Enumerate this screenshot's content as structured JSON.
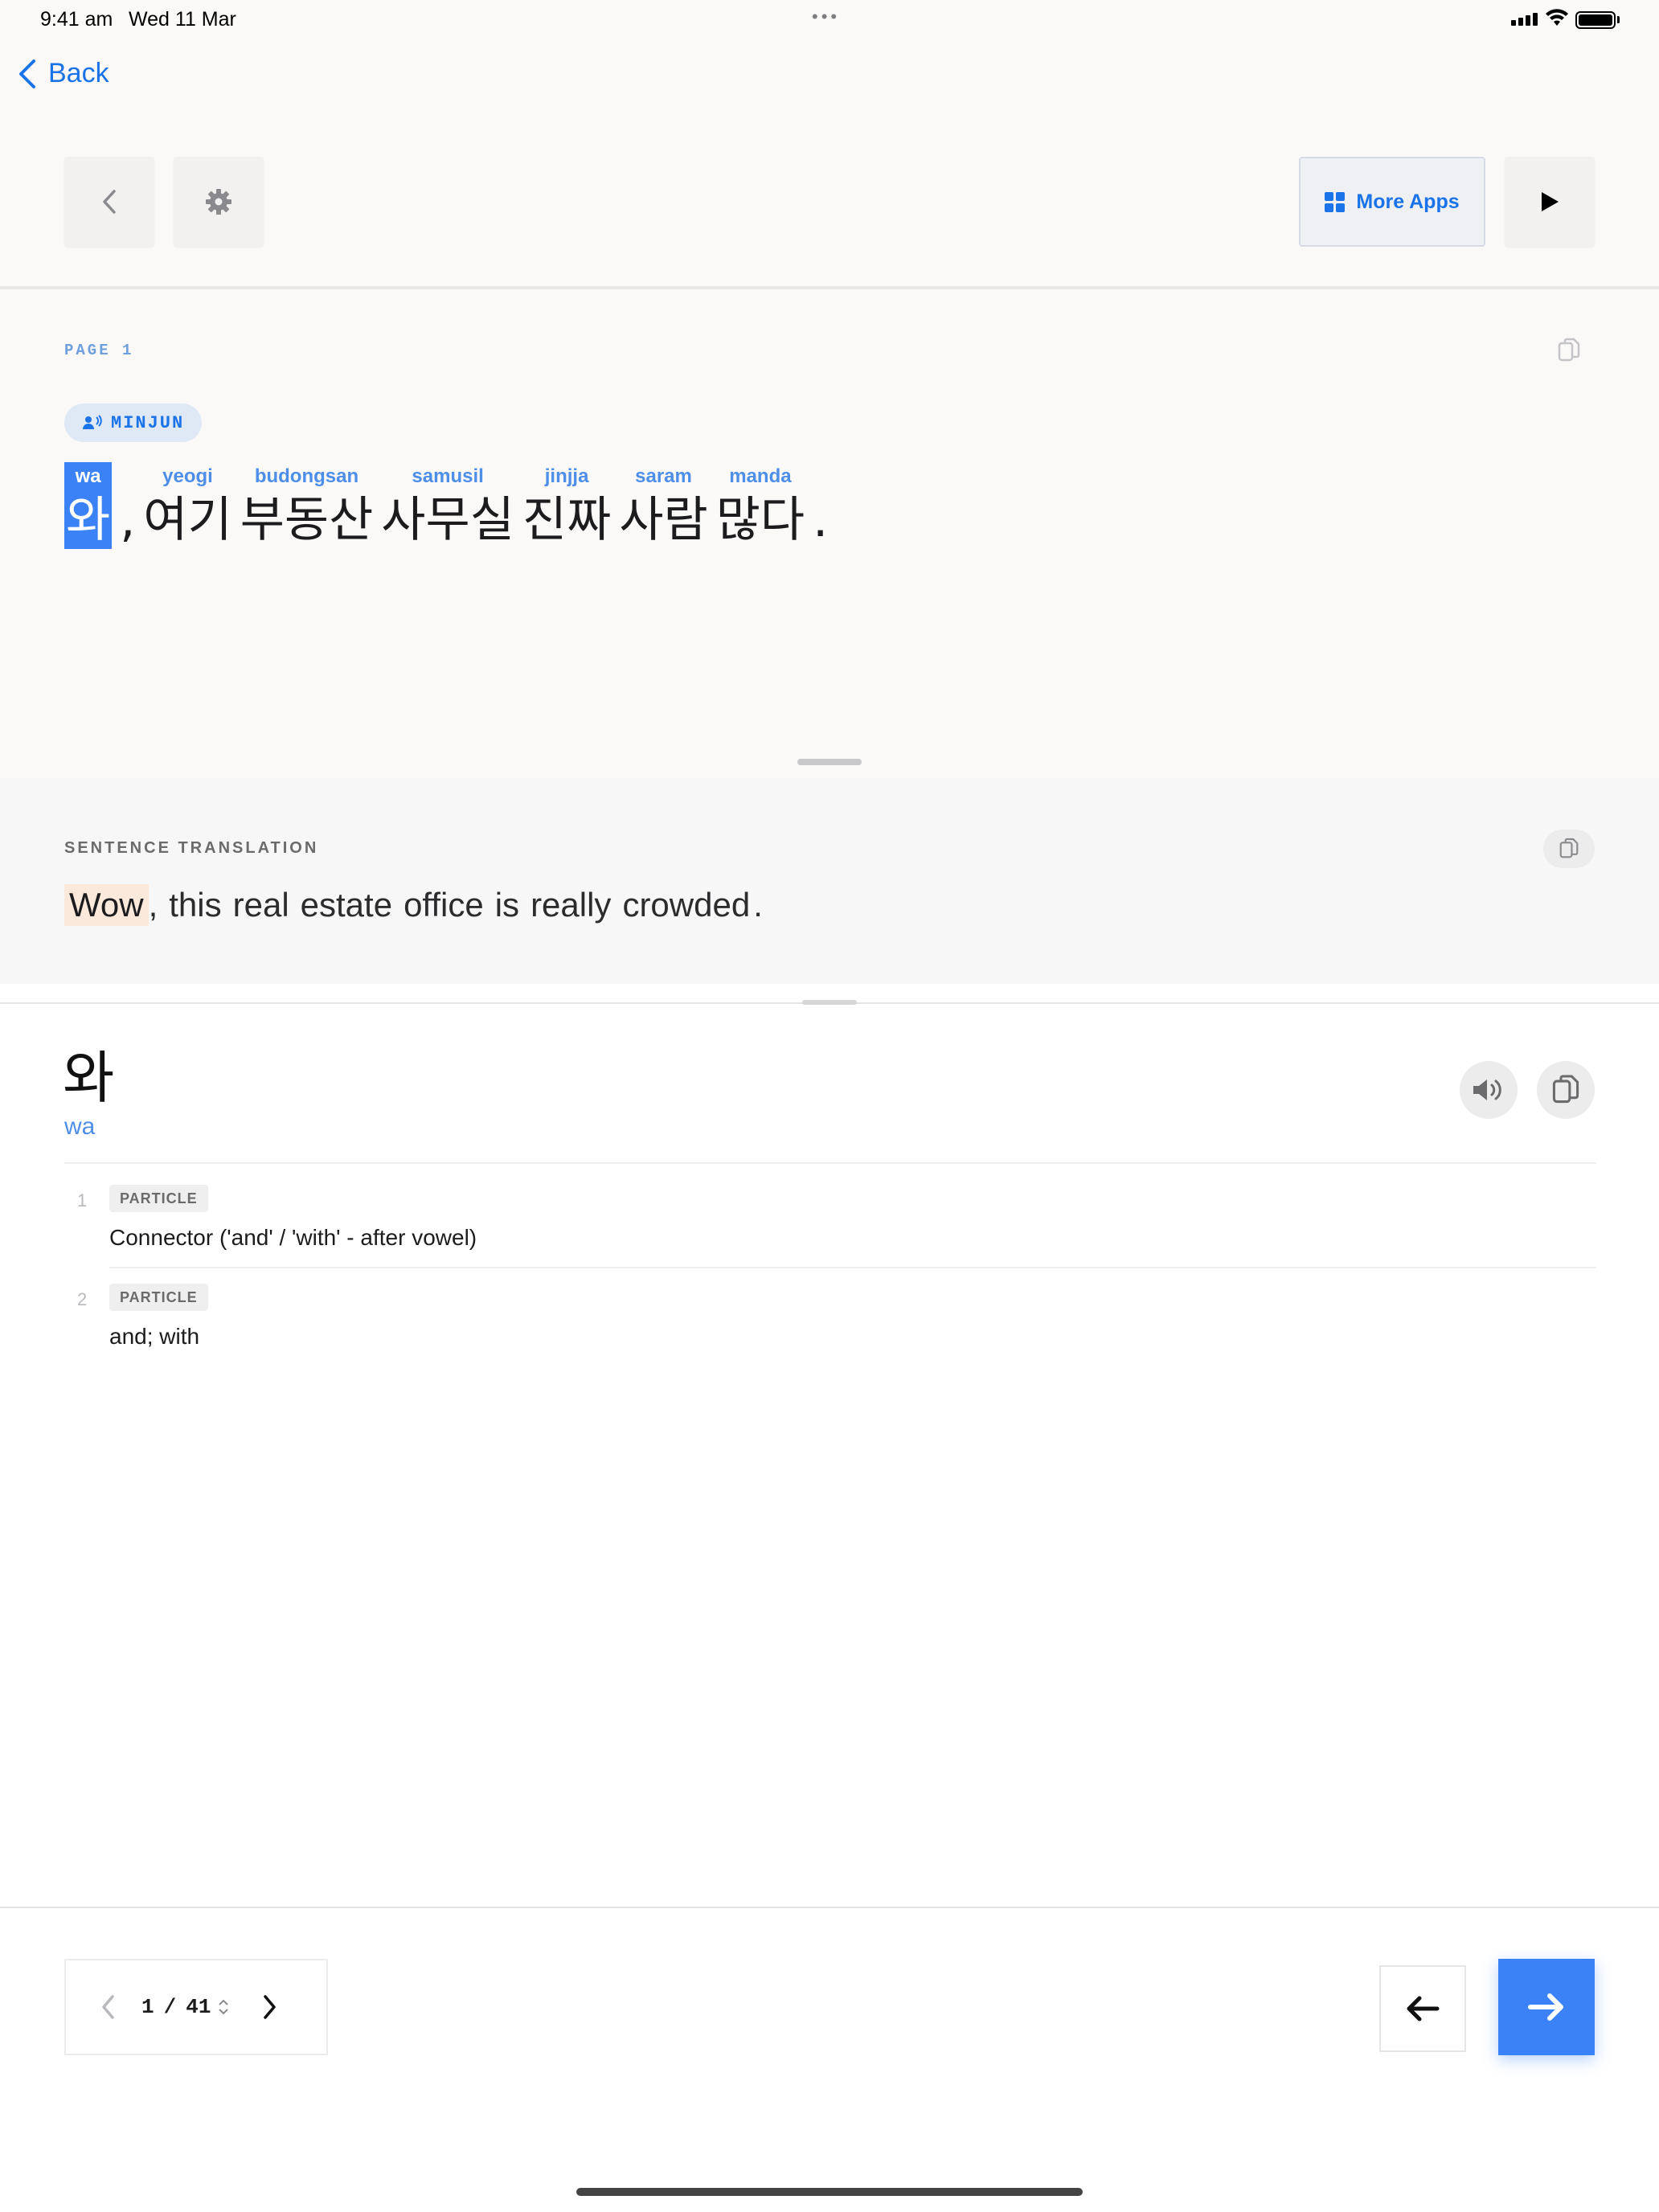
{
  "status_bar": {
    "time": "9:41 am",
    "date": "Wed 11 Mar",
    "dots": "•••"
  },
  "nav": {
    "back_label": "Back"
  },
  "toolbar": {
    "more_apps_label": "More Apps"
  },
  "page": {
    "label": "PAGE 1",
    "speaker": "MINJUN",
    "tokens": [
      {
        "rom": "wa",
        "kor": "와",
        "active": true
      },
      {
        "rom": "yeogi",
        "kor": "여기"
      },
      {
        "rom": "budongsan",
        "kor": "부동산"
      },
      {
        "rom": "samusil",
        "kor": "사무실"
      },
      {
        "rom": "jinjja",
        "kor": "진짜"
      },
      {
        "rom": "saram",
        "kor": "사람"
      },
      {
        "rom": "manda",
        "kor": "많다"
      }
    ],
    "comma": ",",
    "period": "."
  },
  "translation": {
    "label": "SENTENCE TRANSLATION",
    "highlight": "Wow",
    "rest": [
      ",",
      "this",
      "real",
      "estate",
      "office",
      "is",
      "really",
      "crowded",
      "."
    ]
  },
  "dictionary": {
    "word": "와",
    "romanization": "wa",
    "definitions": [
      {
        "num": "1",
        "pos": "PARTICLE",
        "text": "Connector ('and' / 'with' - after vowel)"
      },
      {
        "num": "2",
        "pos": "PARTICLE",
        "text": "and; with"
      }
    ]
  },
  "pager": {
    "current": "1",
    "separator": "/",
    "total": "41"
  },
  "colors": {
    "accent": "#3b82f6",
    "link": "#1a73e8",
    "highlight": "#fbeadb"
  }
}
